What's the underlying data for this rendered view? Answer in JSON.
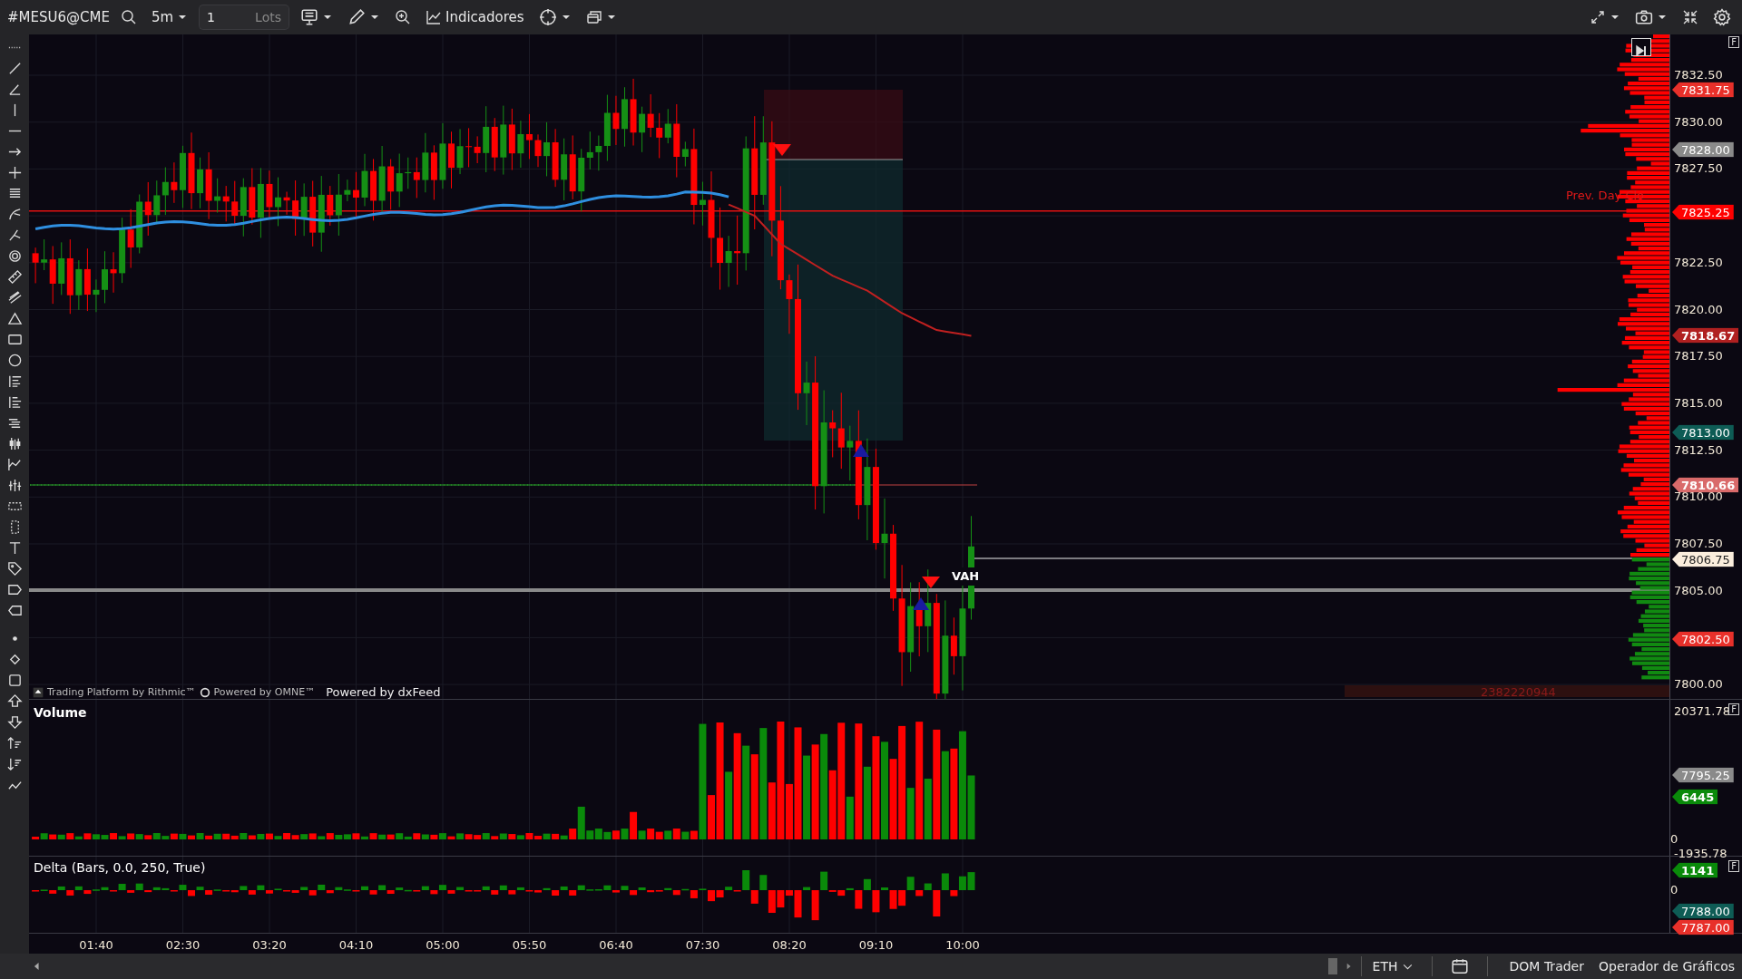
{
  "toolbar": {
    "symbol": "#MESU6@CME",
    "timeframe": "5m",
    "quantity": "1",
    "quantity_unit": "Lots",
    "indicators": "Indicadores"
  },
  "price_pane": {
    "axis_labels": [
      "7832.50",
      "7830.00",
      "7827.50",
      "7822.50",
      "7820.00",
      "7817.50",
      "7815.00",
      "7812.50",
      "7810.00",
      "7807.50",
      "7805.00",
      "7800.00"
    ],
    "tags": [
      {
        "text": "7831.75",
        "color": "#e8302a"
      },
      {
        "text": "7828.00",
        "color": "#8a8a8a"
      },
      {
        "text": "7825.25",
        "color": "#ff0000"
      },
      {
        "text": "7818.67",
        "color": "#b02020"
      },
      {
        "text": "7813.00",
        "color": "#0e5c55"
      },
      {
        "text": "7810.66",
        "color": "#d96a6a"
      },
      {
        "text": "7806.75",
        "color": "#fbeedd"
      },
      {
        "text": "7802.50",
        "color": "#e8302a"
      }
    ],
    "prev_day_close_label": "Prev. Day Clo",
    "vah_label": "VAH",
    "profile_total": "2382220944",
    "credits": [
      "Trading Platform by Rithmic™",
      "Powered by OMNE™",
      "Powered by dxFeed"
    ],
    "axis_badge": "F"
  },
  "volume_pane": {
    "title": "Volume",
    "axis_max": "20371.78",
    "axis_zero": "0",
    "axis_min": "-1935.78",
    "axis_badge": "F",
    "tags": [
      {
        "text": "7795.25",
        "color": "#8a8a8a"
      },
      {
        "text": "6445",
        "color": "#0a8a0a"
      }
    ]
  },
  "delta_pane": {
    "title": "Delta (Bars, 0.0, 250, True)",
    "axis_zero": "0",
    "axis_badge": "F",
    "tags": [
      {
        "text": "1141",
        "color": "#0a8a0a"
      },
      {
        "text": "7788.00",
        "color": "#0e5c55"
      },
      {
        "text": "7787.00",
        "color": "#e8302a"
      }
    ]
  },
  "time_axis": [
    "01:40",
    "02:30",
    "03:20",
    "04:10",
    "05:00",
    "05:50",
    "06:40",
    "07:30",
    "08:20",
    "09:10",
    "10:00"
  ],
  "status_bar": {
    "session": "ETH",
    "buttons": [
      "DOM Trader",
      "Operador de Gráficos"
    ]
  }
}
